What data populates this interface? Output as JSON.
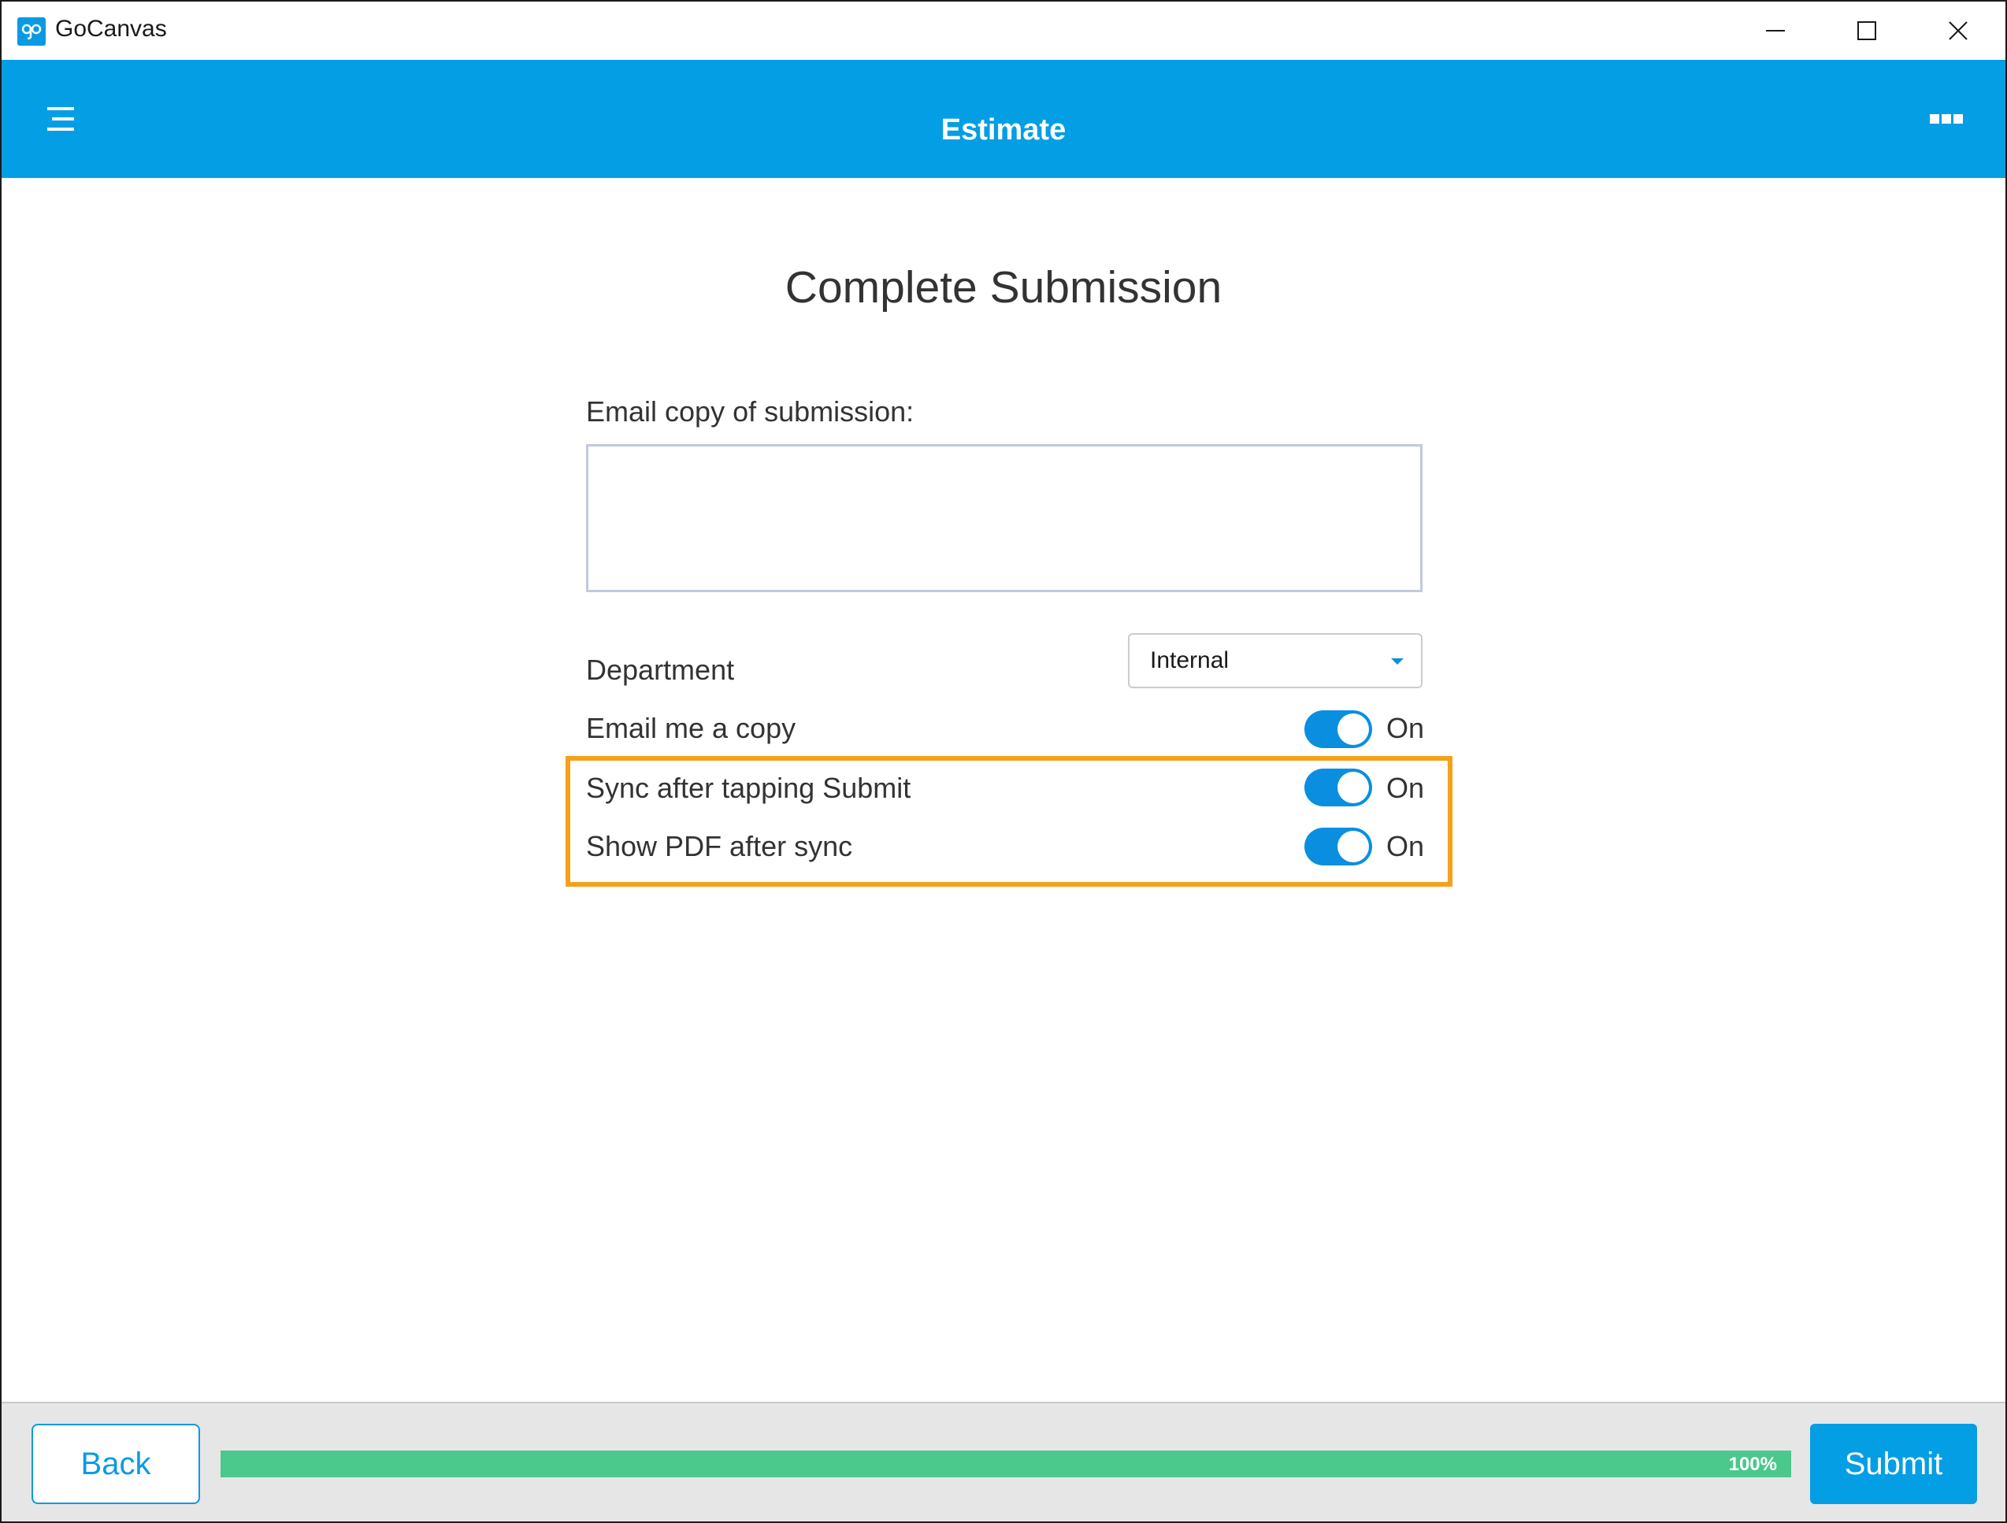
{
  "window": {
    "title": "GoCanvas",
    "icon": "gocanvas-logo"
  },
  "header": {
    "title": "Estimate",
    "menu_icon": "hamburger-icon",
    "more_icon": "more-dots-icon",
    "color": "#049ee4"
  },
  "page": {
    "title": "Complete Submission"
  },
  "form": {
    "email_label": "Email copy of submission:",
    "email_value": "",
    "department": {
      "label": "Department",
      "selected": "Internal"
    },
    "toggles": [
      {
        "label": "Email me a copy",
        "state": "On",
        "on": true
      },
      {
        "label": "Sync after tapping Submit",
        "state": "On",
        "on": true
      },
      {
        "label": "Show PDF after sync",
        "state": "On",
        "on": true
      }
    ],
    "highlight_color": "#f5a11b",
    "toggle_color": "#0a8fe0"
  },
  "footer": {
    "back_label": "Back",
    "submit_label": "Submit",
    "progress_text": "100%",
    "progress_value": 1.0,
    "progress_color": "#4bc88c"
  }
}
